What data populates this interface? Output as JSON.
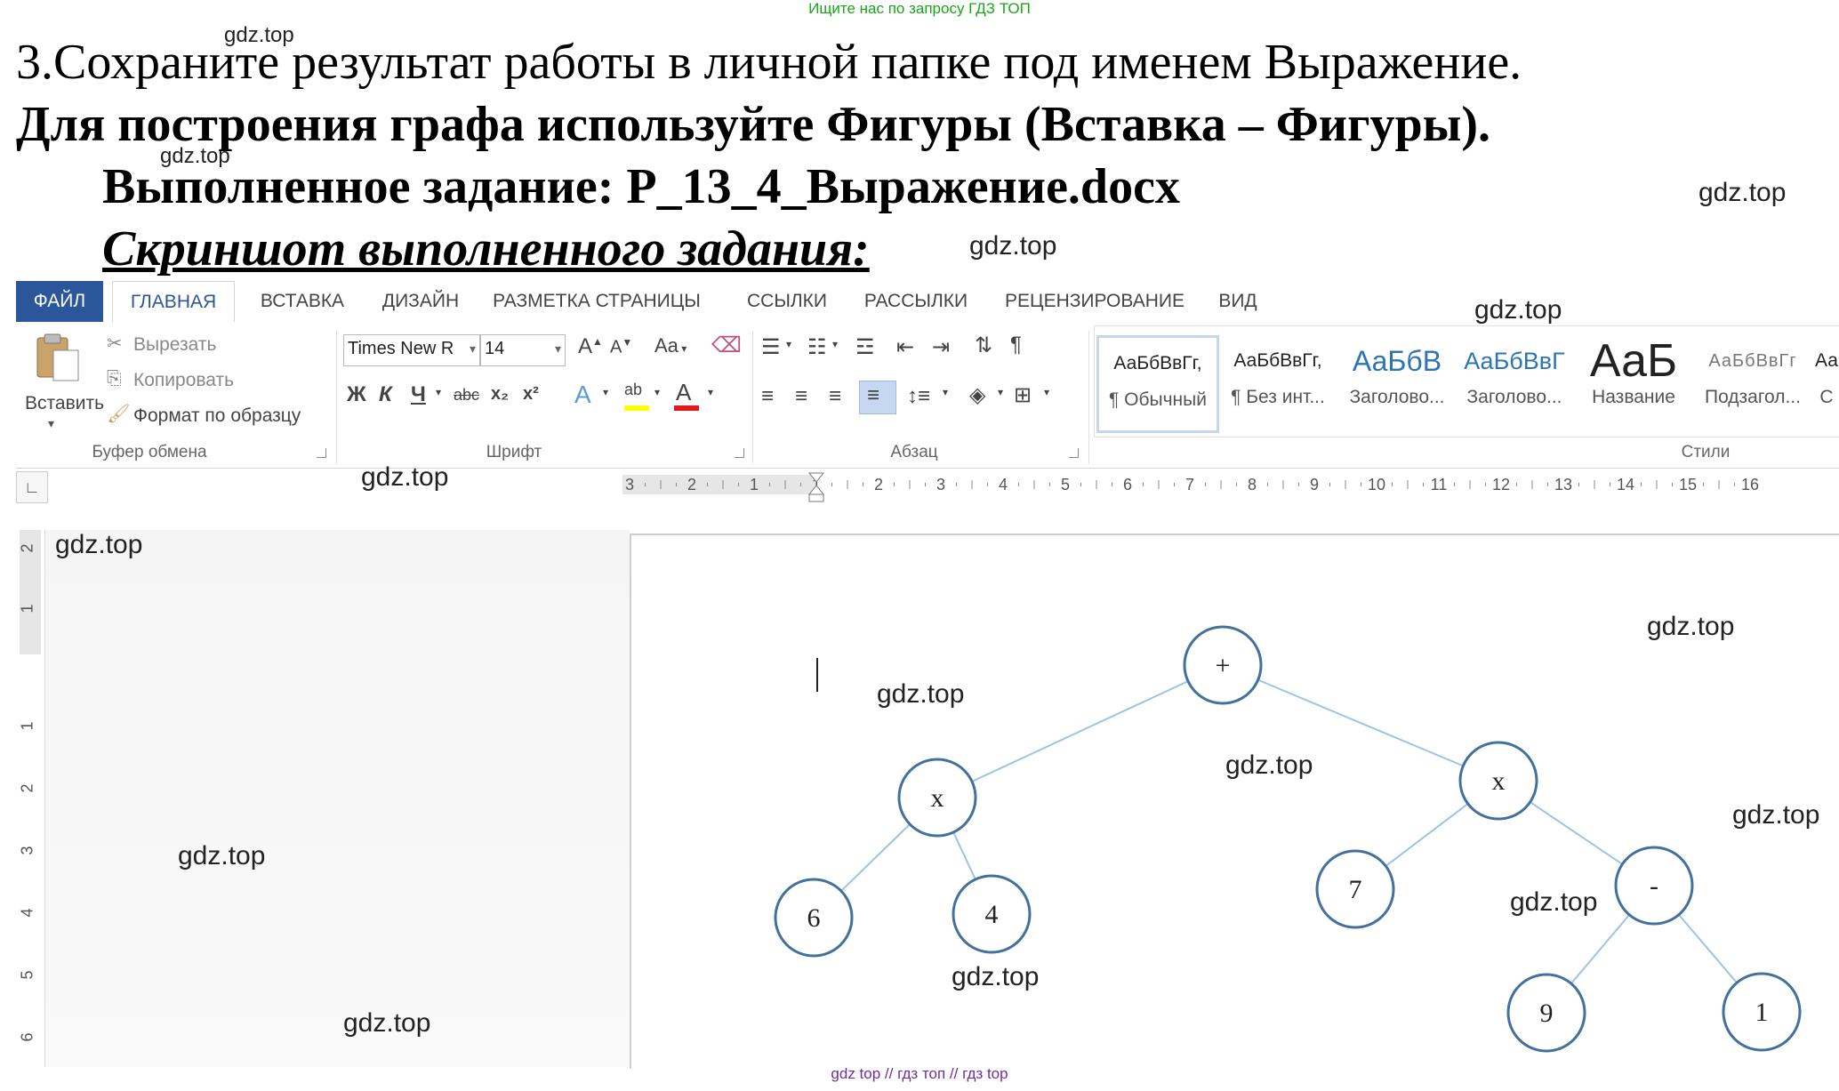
{
  "banner": "Ищите нас по запросу ГДЗ ТОП",
  "task": {
    "line1": "3.Сохраните результат работы в личной папке под именем Выражение.",
    "line2": "Для построения графа используйте Фигуры (Вставка – Фигуры).",
    "line3": "Выполненное задание: P_13_4_Выражение.docx",
    "line4": "Скриншот выполненного задания:"
  },
  "watermark": "gdz.top",
  "tabs": [
    "ФАЙЛ",
    "ГЛАВНАЯ",
    "ВСТАВКА",
    "ДИЗАЙН",
    "РАЗМЕТКА СТРАНИЦЫ",
    "ССЫЛКИ",
    "РАССЫЛКИ",
    "РЕЦЕНЗИРОВАНИЕ",
    "ВИД"
  ],
  "clipboard": {
    "paste": "Вставить",
    "cut": "Вырезать",
    "copy": "Копировать",
    "format_painter": "Формат по образцу",
    "label": "Буфер обмена"
  },
  "font": {
    "name": "Times New R",
    "size": "14",
    "label": "Шрифт",
    "grow": "A",
    "shrink": "A",
    "case": "Aa",
    "bold": "Ж",
    "italic": "К",
    "underline": "Ч",
    "strike": "abc",
    "subscript": "x₂",
    "superscript": "x²",
    "effects": "A",
    "highlight": "ab",
    "color": "A",
    "highlight_color": "#ffff00",
    "font_color": "#e01b1b"
  },
  "paragraph": {
    "label": "Абзац",
    "pilcrow": "¶"
  },
  "styles": {
    "label": "Стили",
    "items": [
      {
        "preview": "АаБбВвГг,",
        "name": "¶ Обычный"
      },
      {
        "preview": "АаБбВвГг,",
        "name": "¶ Без инт..."
      },
      {
        "preview": "АаБбВ",
        "name": "Заголово..."
      },
      {
        "preview": "АаБбВвГ",
        "name": "Заголово..."
      },
      {
        "preview": "АаБ",
        "name": "Название"
      },
      {
        "preview": "АаБбВвГг",
        "name": "Подзагол..."
      },
      {
        "preview": "Аа",
        "name": "С"
      }
    ]
  },
  "ruler": {
    "h_labels": [
      "3",
      "2",
      "1",
      "1",
      "2",
      "3",
      "4",
      "5",
      "6",
      "7",
      "8",
      "9",
      "10",
      "11",
      "12",
      "13",
      "14",
      "15",
      "16"
    ],
    "v_labels": [
      "2",
      "1",
      "1",
      "2",
      "3",
      "4",
      "5",
      "6"
    ]
  },
  "tree": {
    "nodes": [
      {
        "id": "root",
        "label": "+"
      },
      {
        "id": "mul_left",
        "label": "x"
      },
      {
        "id": "mul_right",
        "label": "x"
      },
      {
        "id": "six",
        "label": "6"
      },
      {
        "id": "four",
        "label": "4"
      },
      {
        "id": "seven",
        "label": "7"
      },
      {
        "id": "minus",
        "label": "-"
      },
      {
        "id": "nine",
        "label": "9"
      },
      {
        "id": "one",
        "label": "1"
      }
    ],
    "edges": [
      [
        "root",
        "mul_left"
      ],
      [
        "root",
        "mul_right"
      ],
      [
        "mul_left",
        "six"
      ],
      [
        "mul_left",
        "four"
      ],
      [
        "mul_right",
        "seven"
      ],
      [
        "mul_right",
        "minus"
      ],
      [
        "minus",
        "nine"
      ],
      [
        "minus",
        "one"
      ]
    ],
    "node_color": "#41719c",
    "edge_color": "#9dc3e6"
  },
  "footer": "gdz top  //  гдз топ  //  гдз top",
  "colors": {
    "file_tab": "#2b579a",
    "accent": "#2b579a",
    "banner": "#1aa51a"
  }
}
